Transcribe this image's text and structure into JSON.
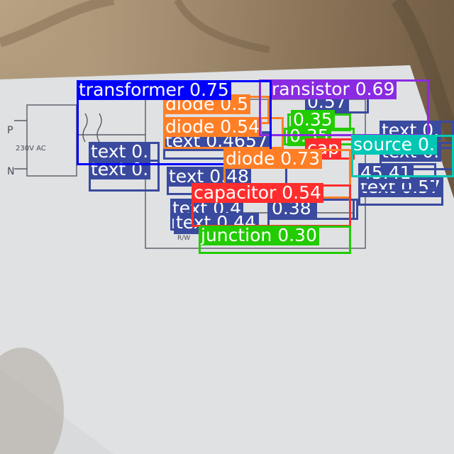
{
  "image": {
    "description_free": true,
    "surface": "fabric",
    "object": "hand-drawn circuit sketch on paper"
  },
  "sketch": {
    "labels": [
      "P",
      "N",
      "230V AC",
      "R/W"
    ]
  },
  "colors": {
    "transformer": "#0000ff",
    "transistor": "#8a2be2",
    "diode": "#ff7f27",
    "text": "#3a4a9e",
    "capacitor": "#ff2d2d",
    "junction": "#22cc00",
    "source": "#00c8b4"
  },
  "detections": [
    {
      "cls": "text",
      "label": "text 0.",
      "color": "#3a4a9e"
    },
    {
      "cls": "text",
      "label": "text 0.",
      "color": "#3a4a9e"
    },
    {
      "cls": "text",
      "label": "text 0.4657",
      "color": "#3a4a9e"
    },
    {
      "cls": "text",
      "label": "text 0.48",
      "color": "#3a4a9e"
    },
    {
      "cls": "text",
      "label": "text 0.4",
      "color": "#3a4a9e"
    },
    {
      "cls": "text",
      "label": "text 0.44",
      "color": "#3a4a9e"
    },
    {
      "cls": "text",
      "label": "0.38",
      "color": "#3a4a9e"
    },
    {
      "cls": "text",
      "label": "text 0.",
      "color": "#3a4a9e"
    },
    {
      "cls": "text",
      "label": "text 0.",
      "color": "#3a4a9e"
    },
    {
      "cls": "text",
      "label": "0.57",
      "color": "#3a4a9e"
    },
    {
      "cls": "text",
      "label": "text 0.57",
      "color": "#3a4a9e"
    },
    {
      "cls": "text",
      "label": "45.41",
      "color": "#3a4a9e"
    },
    {
      "cls": "text",
      "label": "0.38",
      "color": "#3a4a9e"
    },
    {
      "cls": "junction",
      "label": "0.35",
      "color": "#22cc00"
    },
    {
      "cls": "junction",
      "label": "0.35",
      "color": "#22cc00"
    },
    {
      "cls": "capacitor",
      "label": "cap",
      "color": "#ff2d2d"
    },
    {
      "cls": "diode",
      "label": "diode 0.5",
      "color": "#ff7f27"
    },
    {
      "cls": "diode",
      "label": "diode 0.54",
      "color": "#ff7f27"
    },
    {
      "cls": "transistor",
      "label": "ransistor 0.69",
      "color": "#8a2be2"
    },
    {
      "cls": "transformer",
      "label": "transformer 0.75",
      "color": "#0000ff"
    },
    {
      "cls": "diode",
      "label": "diode 0.73",
      "color": "#ff7f27"
    },
    {
      "cls": "source",
      "label": "source 0.",
      "color": "#00c8b4"
    },
    {
      "cls": "capacitor",
      "label": "capacitor 0.54",
      "color": "#ff2d2d"
    },
    {
      "cls": "junction",
      "label": "junction 0.30",
      "color": "#22cc00"
    }
  ]
}
